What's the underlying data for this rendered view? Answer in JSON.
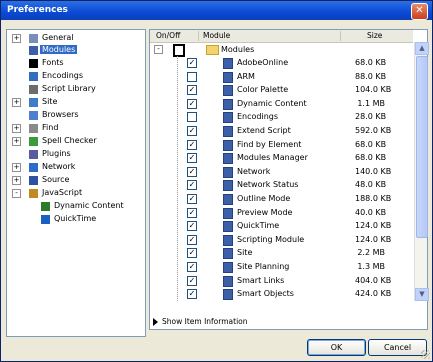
{
  "window": {
    "title": "Preferences",
    "close_label": "✕"
  },
  "sidebar": {
    "items": [
      {
        "label": "General",
        "icon": "general-icon",
        "expander": "+",
        "selected": false
      },
      {
        "label": "Modules",
        "icon": "modules-icon",
        "expander": "",
        "selected": true
      },
      {
        "label": "Fonts",
        "icon": "fonts-icon",
        "expander": "",
        "selected": false
      },
      {
        "label": "Encodings",
        "icon": "encodings-icon",
        "expander": "",
        "selected": false
      },
      {
        "label": "Script Library",
        "icon": "script-library-icon",
        "expander": "",
        "selected": false
      },
      {
        "label": "Site",
        "icon": "site-icon",
        "expander": "+",
        "selected": false
      },
      {
        "label": "Browsers",
        "icon": "browsers-icon",
        "expander": "",
        "selected": false
      },
      {
        "label": "Find",
        "icon": "find-icon",
        "expander": "+",
        "selected": false
      },
      {
        "label": "Spell Checker",
        "icon": "spell-checker-icon",
        "expander": "+",
        "selected": false
      },
      {
        "label": "Plugins",
        "icon": "plugins-icon",
        "expander": "",
        "selected": false
      },
      {
        "label": "Network",
        "icon": "network-icon",
        "expander": "+",
        "selected": false
      },
      {
        "label": "Source",
        "icon": "source-icon",
        "expander": "+",
        "selected": false
      },
      {
        "label": "JavaScript",
        "icon": "javascript-icon",
        "expander": "-",
        "selected": false
      },
      {
        "label": "Dynamic Content",
        "icon": "dynamic-content-icon",
        "expander": "",
        "selected": false
      },
      {
        "label": "QuickTime",
        "icon": "quicktime-icon",
        "expander": "",
        "selected": false
      }
    ]
  },
  "panel": {
    "headers": {
      "onoff": "On/Off",
      "module": "Module",
      "size": "Size"
    },
    "root": {
      "label": "Modules",
      "expander": "-"
    },
    "rows": [
      {
        "name": "AdobeOnline",
        "size": "68.0 KB",
        "checked": true
      },
      {
        "name": "ARM",
        "size": "88.0 KB",
        "checked": false
      },
      {
        "name": "Color Palette",
        "size": "104.0 KB",
        "checked": true
      },
      {
        "name": "Dynamic Content",
        "size": "1.1 MB",
        "checked": true
      },
      {
        "name": "Encodings",
        "size": "28.0 KB",
        "checked": false
      },
      {
        "name": "Extend Script",
        "size": "592.0 KB",
        "checked": true
      },
      {
        "name": "Find by Element",
        "size": "68.0 KB",
        "checked": true
      },
      {
        "name": "Modules Manager",
        "size": "68.0 KB",
        "checked": true
      },
      {
        "name": "Network",
        "size": "140.0 KB",
        "checked": true
      },
      {
        "name": "Network Status",
        "size": "48.0 KB",
        "checked": true
      },
      {
        "name": "Outline Mode",
        "size": "188.0 KB",
        "checked": true
      },
      {
        "name": "Preview Mode",
        "size": "40.0 KB",
        "checked": true
      },
      {
        "name": "QuickTime",
        "size": "124.0 KB",
        "checked": true
      },
      {
        "name": "Scripting Module",
        "size": "124.0 KB",
        "checked": true
      },
      {
        "name": "Site",
        "size": "2.2 MB",
        "checked": true
      },
      {
        "name": "Site Planning",
        "size": "1.3 MB",
        "checked": true
      },
      {
        "name": "Smart Links",
        "size": "404.0 KB",
        "checked": true
      },
      {
        "name": "Smart Objects",
        "size": "424.0 KB",
        "checked": true
      }
    ],
    "scroll_up": "▲",
    "scroll_down": "▼"
  },
  "footer": {
    "show_info": "Show Item Information",
    "ok": "OK",
    "cancel": "Cancel"
  }
}
